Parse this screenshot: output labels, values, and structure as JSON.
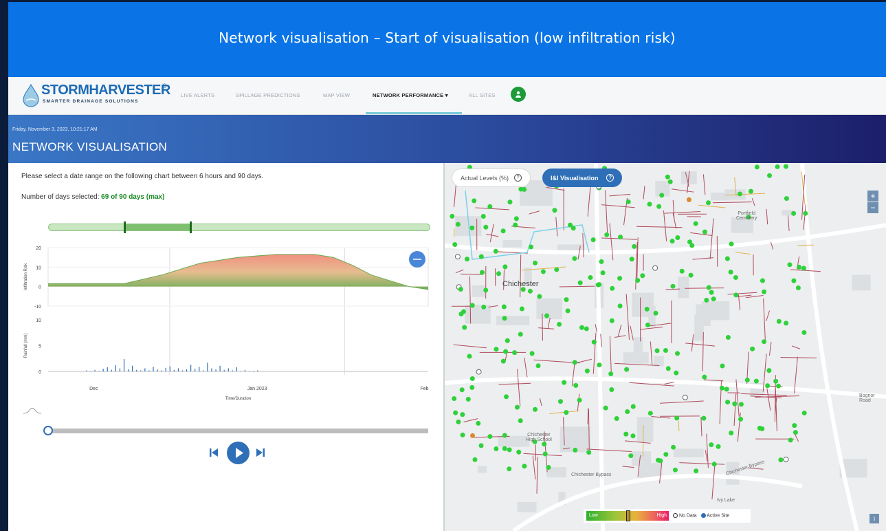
{
  "banner": {
    "title": "Network visualisation – Start of visualisation (low infiltration risk)"
  },
  "app": {
    "logo": {
      "name": "STORMHARVESTER",
      "reg": "®",
      "tagline": "SMARTER DRAINAGE SOLUTIONS"
    },
    "nav": [
      {
        "label": "LIVE ALERTS"
      },
      {
        "label": "SPILLAGE PREDICTIONS"
      },
      {
        "label": "MAP VIEW"
      },
      {
        "label": "NETWORK PERFORMANCE",
        "active": true
      },
      {
        "label": "ALL SITES"
      }
    ],
    "header": {
      "datetime": "Friday, November 3, 2023, 10:21:17 AM",
      "title": "NETWORK VISUALISATION"
    }
  },
  "left_panel": {
    "instructions": "Please select a date range on the following chart between 6 hours and 90 days.",
    "days_label": "Number of days selected:",
    "days_value": "69 of 90 days (max)",
    "range_selection": {
      "start_fraction": 0.2,
      "end_fraction": 0.37
    },
    "playback": {
      "progress_fraction": 0.0
    }
  },
  "chart_data": [
    {
      "type": "area",
      "ylabel": "Infiltration Risk",
      "ylim": [
        -10,
        20
      ],
      "y_ticks": [
        20,
        10,
        0,
        -10
      ],
      "x": [
        0,
        0.1,
        0.2,
        0.3,
        0.4,
        0.5,
        0.6,
        0.7,
        0.75,
        0.8,
        0.85,
        0.9,
        0.95,
        1.0
      ],
      "values": [
        1.5,
        1.5,
        1.5,
        6,
        12,
        15,
        16.5,
        16.5,
        15,
        11,
        6,
        3,
        0,
        -1.5
      ],
      "colors": {
        "low": "#6aab4f",
        "mid": "#e6b98a",
        "high": "#f08a7a"
      }
    },
    {
      "type": "bar",
      "ylabel": "Rainfall (mm)",
      "xlabel": "Time/Duration",
      "ylim": [
        0,
        10
      ],
      "y_ticks": [
        10,
        5,
        0
      ],
      "x_tick_labels": [
        "Dec",
        "Jan 2023",
        "Feb"
      ],
      "values": [
        0.2,
        0.1,
        0.3,
        0.1,
        0.5,
        0.8,
        0.3,
        1.2,
        0.6,
        2.4,
        0.4,
        1.1,
        0.3,
        0.2,
        0.6,
        0.2,
        0.9,
        0.4,
        0.2,
        0.7,
        1.0,
        0.3,
        0.6,
        0.2,
        0.4,
        1.3,
        0.5,
        0.9,
        0.2,
        1.7,
        0.6,
        0.4,
        1.1,
        0.3,
        0.6,
        0.2,
        0.8,
        0.1,
        0.3,
        0.1,
        0.1,
        0.2
      ],
      "color": "#2f6fb7"
    }
  ],
  "map": {
    "buttons": {
      "actual": "Actual Levels (%)",
      "ii": "I&I Visualisation"
    },
    "zoom_in": "+",
    "zoom_out": "−",
    "labels": {
      "city": "Chichester",
      "cemetery": "Portfield\nCemetery",
      "school": "Chichester\nHigh School",
      "bypass1": "Chichester Bypass",
      "bypass2": "Chichester Bypass",
      "bognor": "Bognor Road",
      "lake": "Ivy Lake"
    },
    "legend": {
      "low": "Low",
      "high": "High",
      "nodata": "No Data",
      "active": "Active Site"
    },
    "info": "i"
  }
}
